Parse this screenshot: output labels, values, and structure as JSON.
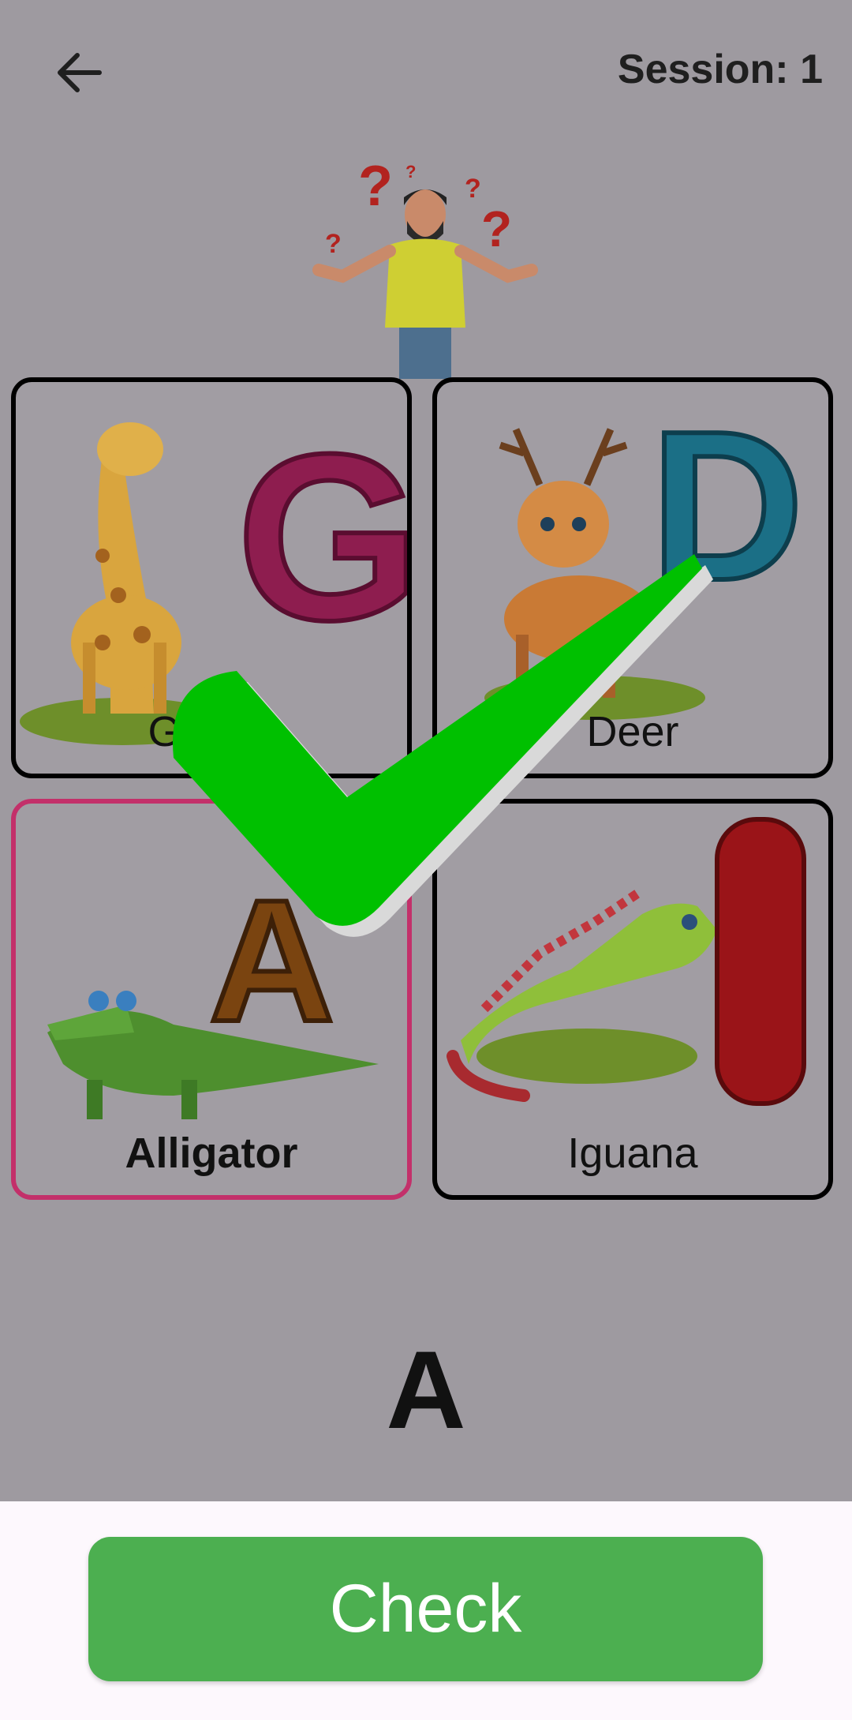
{
  "header": {
    "back_icon": "arrow-left-icon",
    "session_label": "Session: 1"
  },
  "illustration": {
    "icon": "confused-man-icon"
  },
  "cards": [
    {
      "letter": "G",
      "label": "Giraffe",
      "animal_icon": "giraffe-icon",
      "letter_color": "#8e1d4f"
    },
    {
      "letter": "D",
      "label": "Deer",
      "animal_icon": "deer-icon",
      "letter_color": "#1b6f86"
    },
    {
      "letter": "A",
      "label": "Alligator",
      "animal_icon": "alligator-icon",
      "letter_color": "#7a4410",
      "selected": true
    },
    {
      "letter": "I",
      "label": "Iguana",
      "animal_icon": "iguana-icon",
      "letter_color": "#9a1418"
    }
  ],
  "feedback": {
    "icon": "checkmark-icon",
    "color": "#00c000"
  },
  "target_letter": "A",
  "actions": {
    "check_label": "Check",
    "check_color": "#4caf50"
  }
}
